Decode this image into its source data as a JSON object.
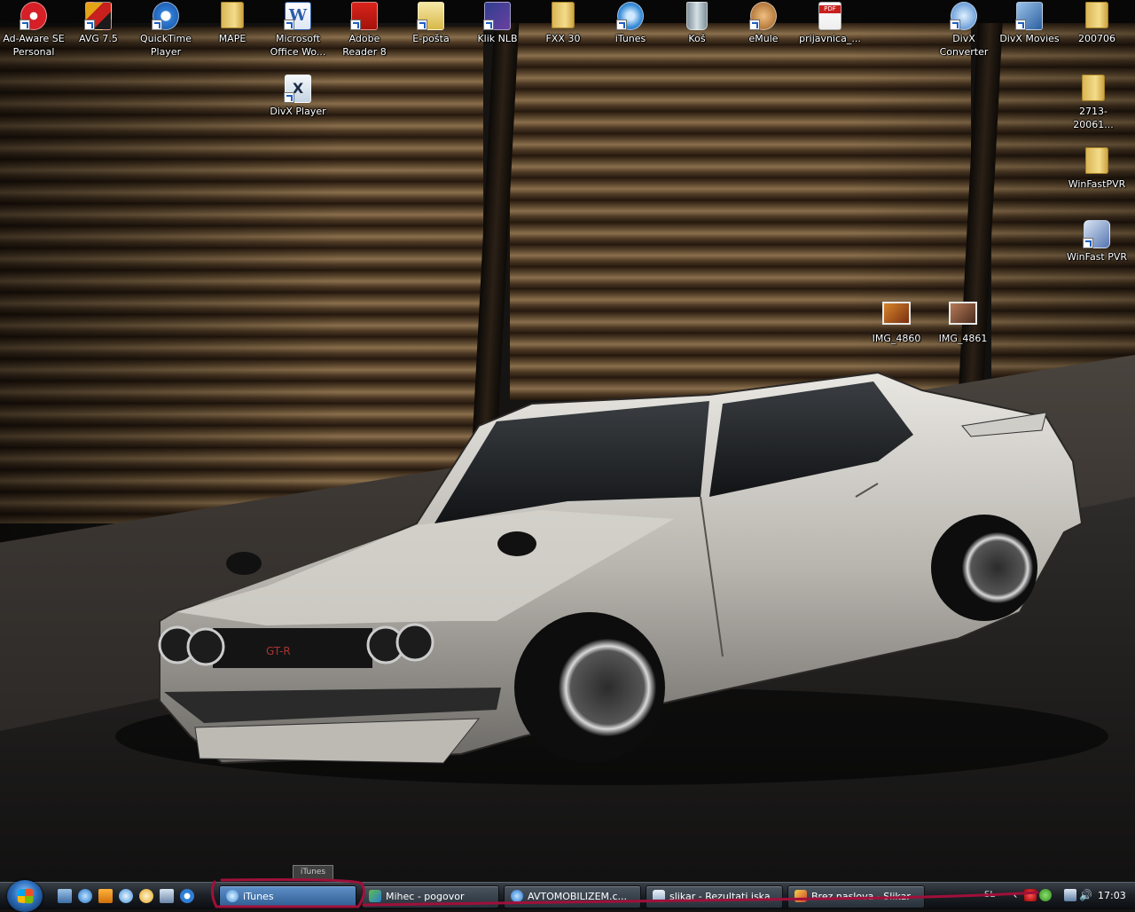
{
  "desktop": {
    "icons": [
      {
        "label": "Ad-Aware SE Personal",
        "icon": "adaware-icon"
      },
      {
        "label": "AVG 7.5",
        "icon": "avg-icon"
      },
      {
        "label": "QuickTime Player",
        "icon": "quicktime-icon"
      },
      {
        "label": "MAPE",
        "icon": "folder-icon"
      },
      {
        "label": "Microsoft Office Wo...",
        "icon": "word-icon"
      },
      {
        "label": "Adobe Reader 8",
        "icon": "adobe-reader-icon"
      },
      {
        "label": "E-pošta",
        "icon": "email-icon"
      },
      {
        "label": "Klik NLB",
        "icon": "klik-nlb-icon"
      },
      {
        "label": "FXX 30",
        "icon": "folder-icon"
      },
      {
        "label": "iTunes",
        "icon": "itunes-icon"
      },
      {
        "label": "Koš",
        "icon": "recycle-bin-icon"
      },
      {
        "label": "eMule",
        "icon": "emule-icon"
      },
      {
        "label": "prijavnica_...",
        "icon": "pdf-file-icon"
      },
      {
        "label": "DivX Converter",
        "icon": "divx-converter-icon"
      },
      {
        "label": "DivX Movies",
        "icon": "divx-movies-icon"
      },
      {
        "label": "200706",
        "icon": "folder-icon"
      },
      {
        "label": "DivX Player",
        "icon": "divx-player-icon"
      },
      {
        "label": "2713-20061...",
        "icon": "folder-icon"
      },
      {
        "label": "WinFastPVR",
        "icon": "folder-icon"
      },
      {
        "label": "WinFast PVR",
        "icon": "winfast-icon"
      },
      {
        "label": "IMG_4860",
        "icon": "image-file-icon"
      },
      {
        "label": "IMG_4861",
        "icon": "image-file-icon"
      }
    ]
  },
  "taskbar": {
    "start_label": "Start",
    "quick_launch": [
      "show-desktop-icon",
      "internet-explorer-icon",
      "media-player-icon",
      "itunes-icon",
      "clock-app-icon",
      "network-icon",
      "quicktime-icon"
    ],
    "tasks": [
      {
        "label": "iTunes",
        "icon": "itunes-icon",
        "active": true
      },
      {
        "label": "Mihec - pogovor",
        "icon": "messenger-icon",
        "active": false
      },
      {
        "label": "AVTOMOBILIZEM.c...",
        "icon": "internet-explorer-icon",
        "active": false
      },
      {
        "label": "slikar - Rezultati iska...",
        "icon": "explorer-icon",
        "active": false
      },
      {
        "label": "Brez naslova - Slikar",
        "icon": "paint-icon",
        "active": false
      }
    ],
    "tray": {
      "language": "SL",
      "icons": [
        "show-hidden-icon",
        "security-icon",
        "messenger-status-icon",
        "network-tray-icon",
        "volume-icon"
      ],
      "clock": "17:03"
    },
    "tooltip": "iTunes"
  },
  "colors": {
    "annotation": "#a0103a",
    "taskbar_active": "#3f73ad"
  }
}
